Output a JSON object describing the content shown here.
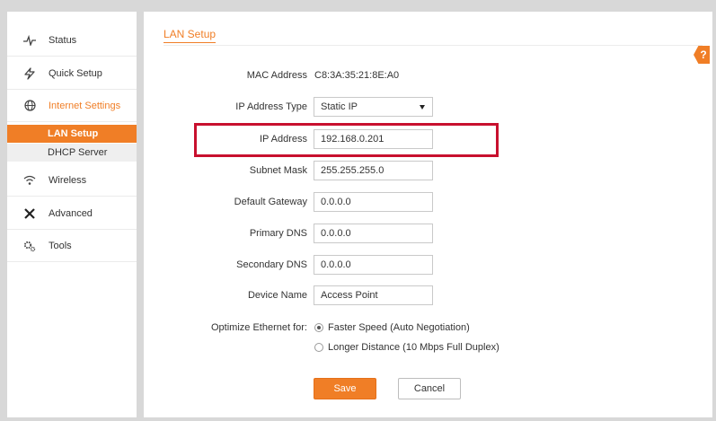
{
  "sidebar": {
    "items": [
      {
        "label": "Status",
        "icon": "pulse-icon"
      },
      {
        "label": "Quick Setup",
        "icon": "lightning-icon"
      },
      {
        "label": "Internet Settings",
        "icon": "globe-icon"
      },
      {
        "label": "Wireless",
        "icon": "wifi-icon"
      },
      {
        "label": "Advanced",
        "icon": "tools-cross-icon"
      },
      {
        "label": "Tools",
        "icon": "gears-icon"
      }
    ],
    "sub_items": [
      {
        "label": "LAN Setup",
        "active": true
      },
      {
        "label": "DHCP Server",
        "active": false
      }
    ]
  },
  "main": {
    "tab_title": "LAN Setup",
    "help_label": "?",
    "fields": {
      "mac": {
        "label": "MAC Address",
        "value": "C8:3A:35:21:8E:A0"
      },
      "ip_type": {
        "label": "IP Address Type",
        "value": "Static IP"
      },
      "ip": {
        "label": "IP Address",
        "value": "192.168.0.201"
      },
      "subnet": {
        "label": "Subnet Mask",
        "value": "255.255.255.0"
      },
      "gateway": {
        "label": "Default Gateway",
        "value": "0.0.0.0"
      },
      "dns1": {
        "label": "Primary DNS",
        "value": "0.0.0.0"
      },
      "dns2": {
        "label": "Secondary DNS",
        "value": "0.0.0.0"
      },
      "device_name": {
        "label": "Device Name",
        "value": "Access Point"
      }
    },
    "optimize": {
      "label": "Optimize Ethernet for:",
      "options": [
        {
          "label": "Faster Speed (Auto Negotiation)",
          "checked": true
        },
        {
          "label": "Longer Distance (10 Mbps Full Duplex)",
          "checked": false
        }
      ]
    },
    "save_label": "Save",
    "cancel_label": "Cancel"
  },
  "colors": {
    "accent": "#f07e26",
    "highlight": "#c8102e"
  }
}
